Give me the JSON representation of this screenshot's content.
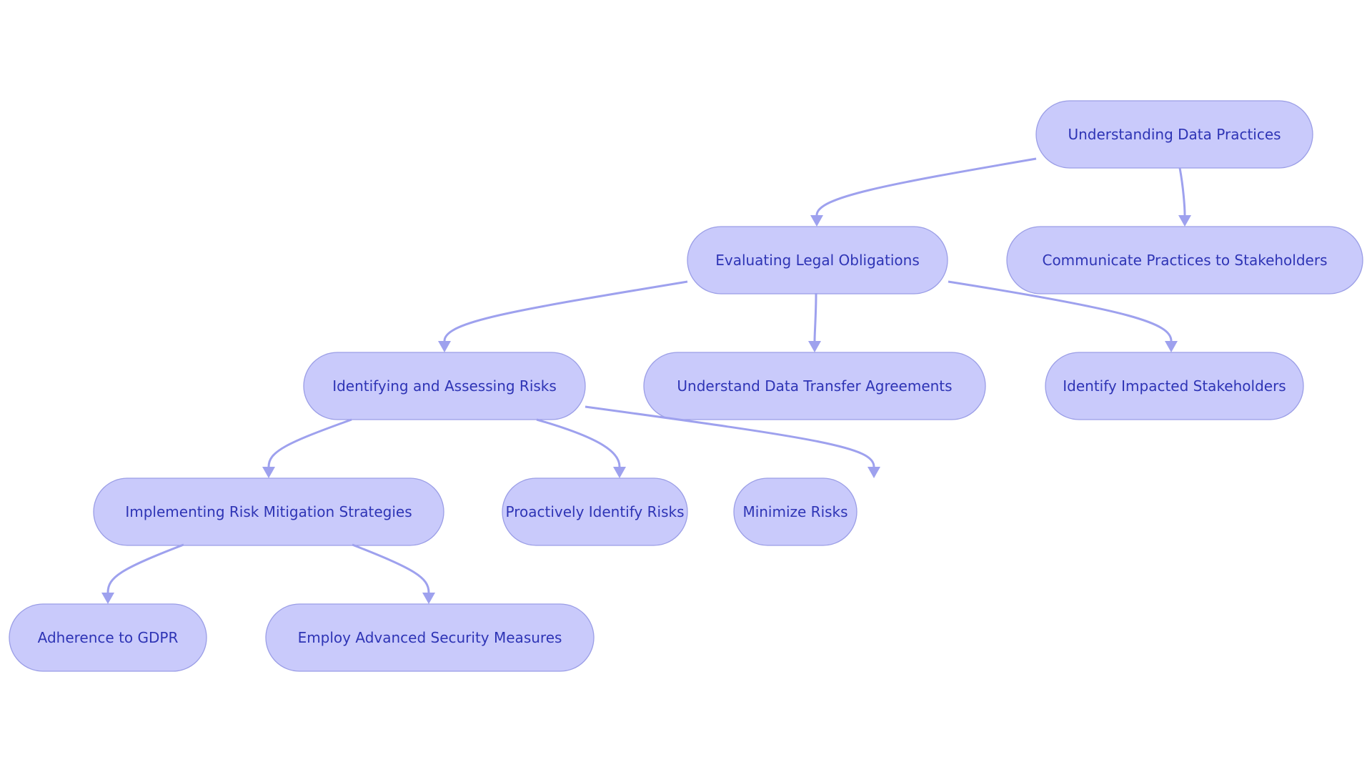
{
  "diagram": {
    "type": "flowchart",
    "direction": "top-down",
    "colors": {
      "node_fill": "#c9cafb",
      "node_border": "#9b9ee6",
      "node_text": "#2e34b5",
      "edge": "#9ea1ee",
      "background": "#ffffff"
    },
    "nodes": [
      {
        "id": "udp",
        "label": "Understanding Data Practices"
      },
      {
        "id": "elo",
        "label": "Evaluating Legal Obligations"
      },
      {
        "id": "cps",
        "label": "Communicate Practices to Stakeholders"
      },
      {
        "id": "iar",
        "label": "Identifying and Assessing Risks"
      },
      {
        "id": "udta",
        "label": "Understand Data Transfer Agreements"
      },
      {
        "id": "iis",
        "label": "Identify Impacted Stakeholders"
      },
      {
        "id": "irms",
        "label": "Implementing Risk Mitigation Strategies"
      },
      {
        "id": "pir",
        "label": "Proactively Identify Risks"
      },
      {
        "id": "mr",
        "label": "Minimize Risks"
      },
      {
        "id": "atg",
        "label": "Adherence to GDPR"
      },
      {
        "id": "easm",
        "label": "Employ Advanced Security Measures"
      }
    ],
    "edges": [
      {
        "from": "udp",
        "to": "elo"
      },
      {
        "from": "udp",
        "to": "cps"
      },
      {
        "from": "elo",
        "to": "iar"
      },
      {
        "from": "elo",
        "to": "udta"
      },
      {
        "from": "elo",
        "to": "iis"
      },
      {
        "from": "iar",
        "to": "irms"
      },
      {
        "from": "iar",
        "to": "pir"
      },
      {
        "from": "iar",
        "to": "mr"
      },
      {
        "from": "irms",
        "to": "atg"
      },
      {
        "from": "irms",
        "to": "easm"
      }
    ]
  }
}
